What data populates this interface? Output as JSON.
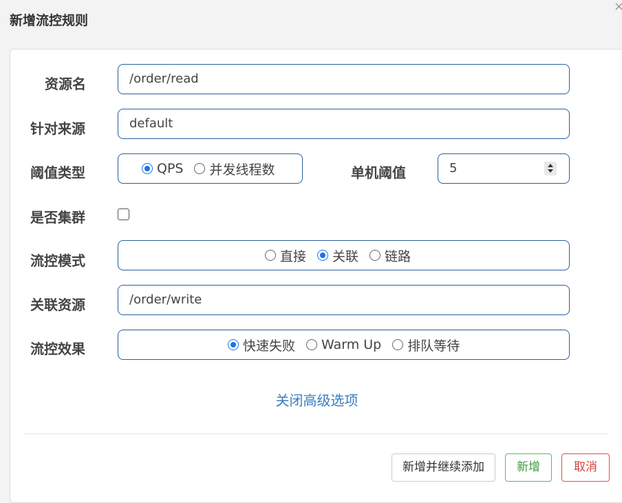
{
  "dialog": {
    "title": "新增流控规则",
    "close": "×"
  },
  "form": {
    "resource_name": {
      "label": "资源名",
      "value": "/order/read"
    },
    "limit_app": {
      "label": "针对来源",
      "value": "default"
    },
    "grade": {
      "label": "阈值类型",
      "options": [
        "QPS",
        "并发线程数"
      ],
      "selected": "QPS"
    },
    "threshold": {
      "label": "单机阈值",
      "value": "5"
    },
    "cluster": {
      "label": "是否集群",
      "checked": false
    },
    "strategy": {
      "label": "流控模式",
      "options": [
        "直接",
        "关联",
        "链路"
      ],
      "selected": "关联"
    },
    "ref_resource": {
      "label": "关联资源",
      "value": "/order/write"
    },
    "control_behavior": {
      "label": "流控效果",
      "options": [
        "快速失败",
        "Warm Up",
        "排队等待"
      ],
      "selected": "快速失败"
    },
    "advanced_toggle": "关闭高级选项"
  },
  "footer": {
    "save_continue": "新增并继续添加",
    "add": "新增",
    "cancel": "取消"
  },
  "colors": {
    "input_border": "#2a5f9e",
    "radio_checked": "#1a73e8",
    "link": "#3a7cc1",
    "add_button": "#5cb85c",
    "cancel_button": "#d9534f"
  }
}
